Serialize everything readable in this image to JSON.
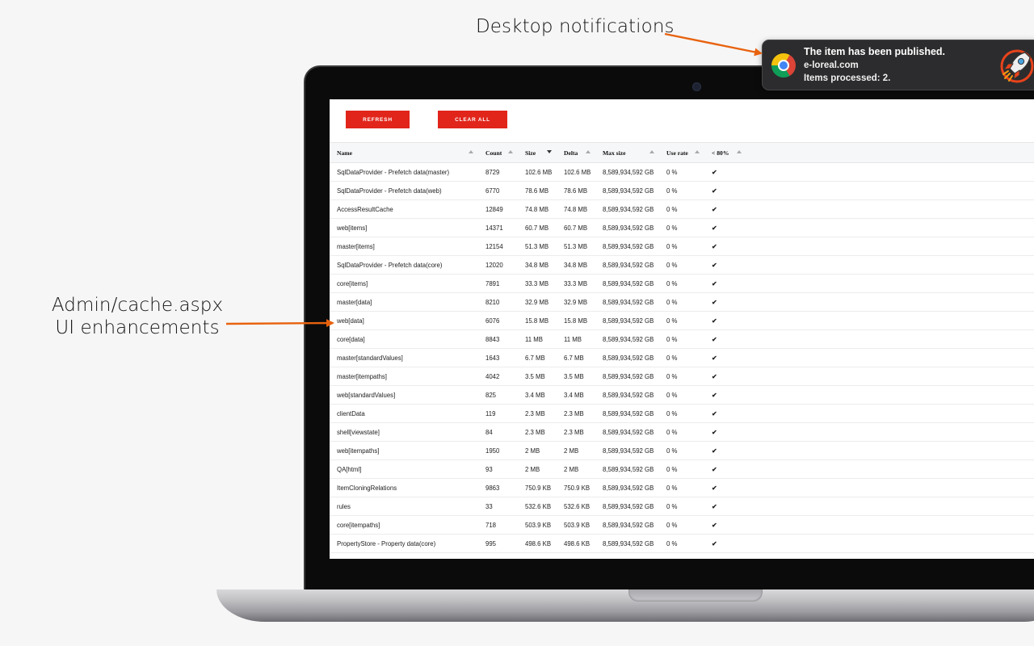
{
  "annotations": {
    "desktop_notifications": "Desktop notifications",
    "admin_line1": "Admin/cache.aspx",
    "admin_line2": "UI enhancements"
  },
  "colors": {
    "accent_red": "#e1251b",
    "arrow_orange": "#e8620e",
    "check_green": "#28a745"
  },
  "notification": {
    "title": "The item has been published.",
    "site": "e-loreal.com",
    "body": "Items processed: 2.",
    "icon": "chrome-icon",
    "image": "rocket-icon"
  },
  "toolbar": {
    "refresh_label": "REFRESH",
    "clear_all_label": "CLEAR ALL"
  },
  "table": {
    "headers": [
      "Name",
      "Count",
      "Size",
      "Delta",
      "Max size",
      "Use rate",
      "< 80%"
    ],
    "rows": [
      [
        "SqlDataProvider - Prefetch data(master)",
        "8729",
        "102.6 MB",
        "102.6 MB",
        "8,589,934,592 GB",
        "0 %",
        "✔"
      ],
      [
        "SqlDataProvider - Prefetch data(web)",
        "6770",
        "78.6 MB",
        "78.6 MB",
        "8,589,934,592 GB",
        "0 %",
        "✔"
      ],
      [
        "AccessResultCache",
        "12849",
        "74.8 MB",
        "74.8 MB",
        "8,589,934,592 GB",
        "0 %",
        "✔"
      ],
      [
        "web[items]",
        "14371",
        "60.7 MB",
        "60.7 MB",
        "8,589,934,592 GB",
        "0 %",
        "✔"
      ],
      [
        "master[items]",
        "12154",
        "51.3 MB",
        "51.3 MB",
        "8,589,934,592 GB",
        "0 %",
        "✔"
      ],
      [
        "SqlDataProvider - Prefetch data(core)",
        "12020",
        "34.8 MB",
        "34.8 MB",
        "8,589,934,592 GB",
        "0 %",
        "✔"
      ],
      [
        "core[items]",
        "7891",
        "33.3 MB",
        "33.3 MB",
        "8,589,934,592 GB",
        "0 %",
        "✔"
      ],
      [
        "master[data]",
        "8210",
        "32.9 MB",
        "32.9 MB",
        "8,589,934,592 GB",
        "0 %",
        "✔"
      ],
      [
        "web[data]",
        "6076",
        "15.8 MB",
        "15.8 MB",
        "8,589,934,592 GB",
        "0 %",
        "✔"
      ],
      [
        "core[data]",
        "8843",
        "11 MB",
        "11 MB",
        "8,589,934,592 GB",
        "0 %",
        "✔"
      ],
      [
        "master[standardValues]",
        "1643",
        "6.7 MB",
        "6.7 MB",
        "8,589,934,592 GB",
        "0 %",
        "✔"
      ],
      [
        "master[itempaths]",
        "4042",
        "3.5 MB",
        "3.5 MB",
        "8,589,934,592 GB",
        "0 %",
        "✔"
      ],
      [
        "web[standardValues]",
        "825",
        "3.4 MB",
        "3.4 MB",
        "8,589,934,592 GB",
        "0 %",
        "✔"
      ],
      [
        "clientData",
        "119",
        "2.3 MB",
        "2.3 MB",
        "8,589,934,592 GB",
        "0 %",
        "✔"
      ],
      [
        "shell[viewstate]",
        "84",
        "2.3 MB",
        "2.3 MB",
        "8,589,934,592 GB",
        "0 %",
        "✔"
      ],
      [
        "web[itempaths]",
        "1950",
        "2 MB",
        "2 MB",
        "8,589,934,592 GB",
        "0 %",
        "✔"
      ],
      [
        "QA[html]",
        "93",
        "2 MB",
        "2 MB",
        "8,589,934,592 GB",
        "0 %",
        "✔"
      ],
      [
        "ItemCloningRelations",
        "9863",
        "750.9 KB",
        "750.9 KB",
        "8,589,934,592 GB",
        "0 %",
        "✔"
      ],
      [
        "rules",
        "33",
        "532.6 KB",
        "532.6 KB",
        "8,589,934,592 GB",
        "0 %",
        "✔"
      ],
      [
        "core[itempaths]",
        "718",
        "503.9 KB",
        "503.9 KB",
        "8,589,934,592 GB",
        "0 %",
        "✔"
      ],
      [
        "PropertyStore - Property data(core)",
        "995",
        "498.6 KB",
        "498.6 KB",
        "8,589,934,592 GB",
        "0 %",
        "✔"
      ]
    ]
  }
}
